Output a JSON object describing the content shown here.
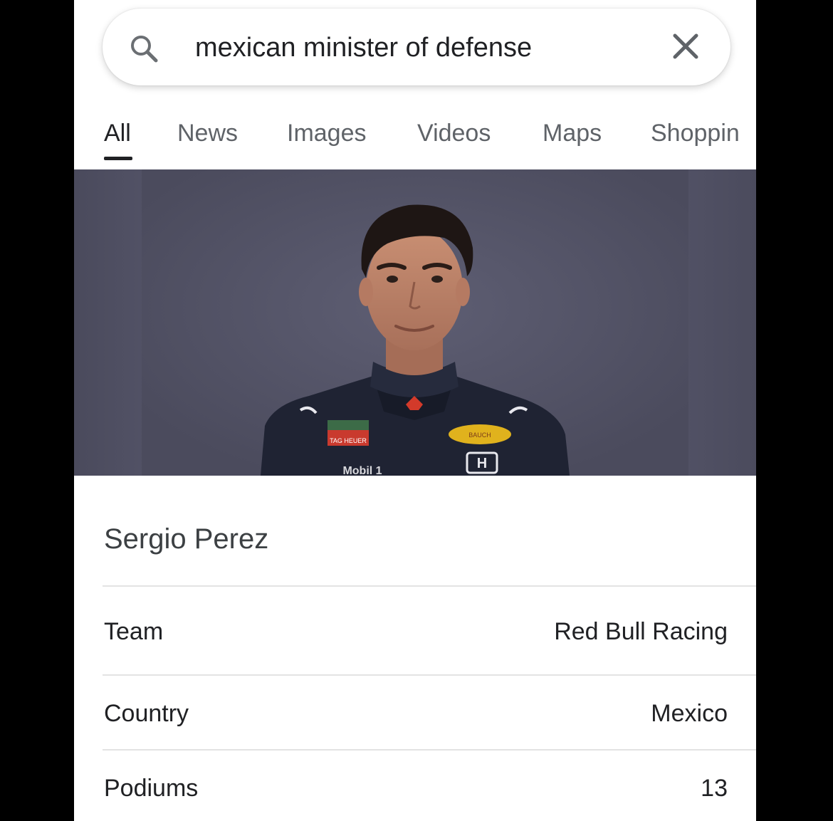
{
  "search": {
    "query": "mexican minister of defense"
  },
  "tabs": [
    {
      "label": "All",
      "active": true
    },
    {
      "label": "News",
      "active": false
    },
    {
      "label": "Images",
      "active": false
    },
    {
      "label": "Videos",
      "active": false
    },
    {
      "label": "Maps",
      "active": false
    },
    {
      "label": "Shoppin",
      "active": false
    }
  ],
  "knowledge_panel": {
    "name": "Sergio Perez",
    "rows": [
      {
        "label": "Team",
        "value": "Red Bull Racing"
      },
      {
        "label": "Country",
        "value": "Mexico"
      },
      {
        "label": "Podiums",
        "value": "13"
      }
    ]
  },
  "photo": {
    "badges": [
      "TAG HEUER",
      "Mobil 1",
      "BAUCH"
    ],
    "background_color": "#545468"
  }
}
